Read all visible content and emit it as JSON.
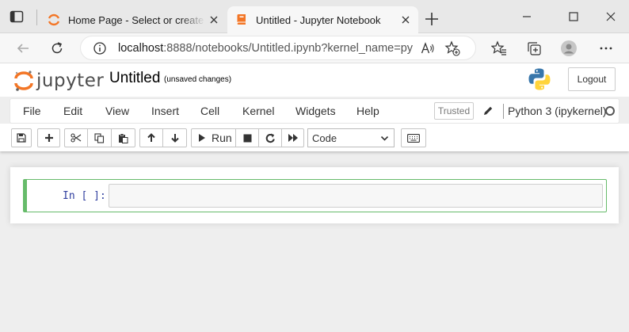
{
  "browser": {
    "tabs": [
      {
        "label": "Home Page - Select or create a notebook",
        "active": false
      },
      {
        "label": "Untitled - Jupyter Notebook",
        "active": true
      }
    ],
    "url_host": "localhost",
    "url_rest": ":8888/notebooks/Untitled.ipynb?kernel_name=py..."
  },
  "header": {
    "logo_text": "jupyter",
    "notebook_name": "Untitled",
    "save_status": "(unsaved changes)",
    "logout_label": "Logout"
  },
  "menu": {
    "items": [
      "File",
      "Edit",
      "View",
      "Insert",
      "Cell",
      "Kernel",
      "Widgets",
      "Help"
    ],
    "trusted_label": "Trusted",
    "kernel_name": "Python 3 (ipykernel)"
  },
  "toolbar": {
    "run_label": "Run",
    "cell_type": "Code"
  },
  "notebook": {
    "cells": [
      {
        "prompt": "In [ ]:",
        "source": ""
      }
    ]
  },
  "colors": {
    "jupyter_orange": "#f37626",
    "cell_selected_border": "#66bb6a",
    "prompt_blue": "#303f9f"
  }
}
